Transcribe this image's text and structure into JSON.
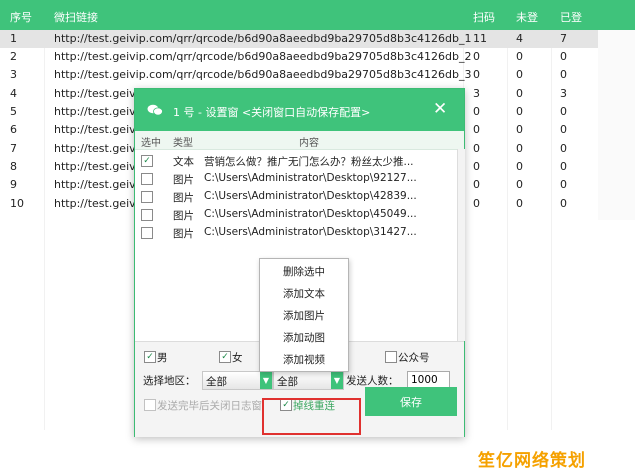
{
  "table": {
    "headers": {
      "index": "序号",
      "link": "微扫链接",
      "scan": "扫码",
      "not_logged": "未登",
      "logged": "已登"
    },
    "rows": [
      {
        "index": "1",
        "link": "http://test.geivip.com/qrr/qrcode/b6d90a8aeedbd9ba29705d8b3c4126db_1",
        "scan": "11",
        "not_logged": "4",
        "logged": "7"
      },
      {
        "index": "2",
        "link": "http://test.geivip.com/qrr/qrcode/b6d90a8aeedbd9ba29705d8b3c4126db_2",
        "scan": "0",
        "not_logged": "0",
        "logged": "0"
      },
      {
        "index": "3",
        "link": "http://test.geivip.com/qrr/qrcode/b6d90a8aeedbd9ba29705d8b3c4126db_3",
        "scan": "0",
        "not_logged": "0",
        "logged": "0"
      },
      {
        "index": "4",
        "link": "http://test.geivi",
        "scan": "3",
        "not_logged": "0",
        "logged": "3"
      },
      {
        "index": "5",
        "link": "http://test.geivi",
        "scan": "0",
        "not_logged": "0",
        "logged": "0"
      },
      {
        "index": "6",
        "link": "http://test.geivi",
        "scan": "0",
        "not_logged": "0",
        "logged": "0"
      },
      {
        "index": "7",
        "link": "http://test.geivi",
        "scan": "0",
        "not_logged": "0",
        "logged": "0"
      },
      {
        "index": "8",
        "link": "http://test.geivi",
        "scan": "0",
        "not_logged": "0",
        "logged": "0"
      },
      {
        "index": "9",
        "link": "http://test.geivi",
        "scan": "0",
        "not_logged": "0",
        "logged": "0"
      },
      {
        "index": "10",
        "link": "http://test.geivi",
        "scan": "0",
        "not_logged": "0",
        "logged": "0"
      }
    ]
  },
  "dialog": {
    "title": "1 号 - 设置窗 <关闭窗口自动保存配置>",
    "close_icon": "✕",
    "columns": {
      "select": "选中",
      "type": "类型",
      "content": "内容"
    },
    "items": [
      {
        "checked": true,
        "type": "文本",
        "content": "营销怎么做？推广无门怎么办？粉丝太少推..."
      },
      {
        "checked": false,
        "type": "图片",
        "content": "C:\\Users\\Administrator\\Desktop\\92127..."
      },
      {
        "checked": false,
        "type": "图片",
        "content": "C:\\Users\\Administrator\\Desktop\\42839..."
      },
      {
        "checked": false,
        "type": "图片",
        "content": "C:\\Users\\Administrator\\Desktop\\45049..."
      },
      {
        "checked": false,
        "type": "图片",
        "content": "C:\\Users\\Administrator\\Desktop\\31427..."
      }
    ],
    "filters": {
      "male": "男",
      "male_checked": true,
      "female": "女",
      "female_checked": true,
      "public_account": "公众号",
      "public_checked": false
    },
    "region_label": "选择地区：",
    "region_value_1": "全部",
    "region_value_2": "全部",
    "send_count_label": "发送人数：",
    "send_count_value": "1000",
    "close_log_label": "发送完毕后关闭日志窗",
    "close_log_checked": false,
    "reconnect_label": "掉线重连",
    "reconnect_checked": true,
    "save_label": "保存"
  },
  "context_menu": {
    "items": [
      "删除选中",
      "添加文本",
      "添加图片",
      "添加动图",
      "添加视频"
    ]
  },
  "watermark": "笙亿网络策划",
  "colors": {
    "accent": "#3fc37b",
    "highlight_box": "#e0312f",
    "watermark": "#f5a100"
  }
}
